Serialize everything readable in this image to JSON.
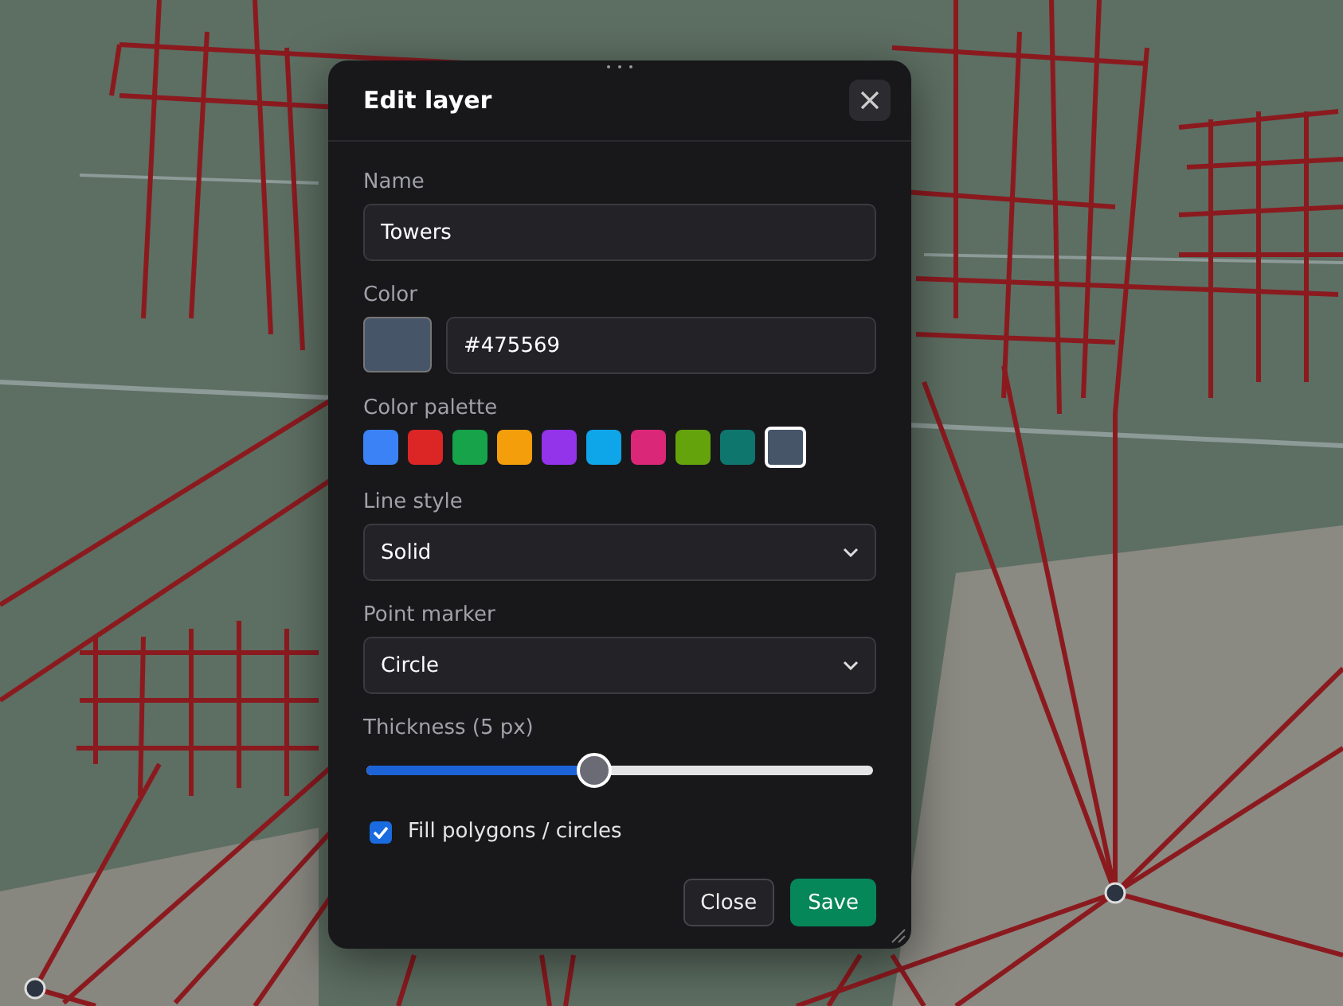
{
  "dialog": {
    "title": "Edit layer",
    "name_field": {
      "label": "Name",
      "value": "Towers"
    },
    "color_field": {
      "label": "Color",
      "color": "#475569",
      "value": "#475569"
    },
    "palette": {
      "label": "Color palette",
      "swatches": [
        {
          "color": "#3b82f6",
          "selected": false
        },
        {
          "color": "#dc2626",
          "selected": false
        },
        {
          "color": "#16a34a",
          "selected": false
        },
        {
          "color": "#f59e0b",
          "selected": false
        },
        {
          "color": "#9333ea",
          "selected": false
        },
        {
          "color": "#0ea5e9",
          "selected": false
        },
        {
          "color": "#db2777",
          "selected": false
        },
        {
          "color": "#65a30d",
          "selected": false
        },
        {
          "color": "#0f766e",
          "selected": false
        },
        {
          "color": "#475569",
          "selected": true
        }
      ]
    },
    "line_style": {
      "label": "Line style",
      "value": "Solid"
    },
    "point_marker": {
      "label": "Point marker",
      "value": "Circle"
    },
    "thickness": {
      "label": "Thickness (5 px)",
      "level": 0.45
    },
    "fill": {
      "label": "Fill polygons / circles",
      "checked": true
    },
    "buttons": [
      {
        "label": "Close",
        "kind": "secondary"
      },
      {
        "label": "Save",
        "kind": "primary"
      }
    ]
  }
}
